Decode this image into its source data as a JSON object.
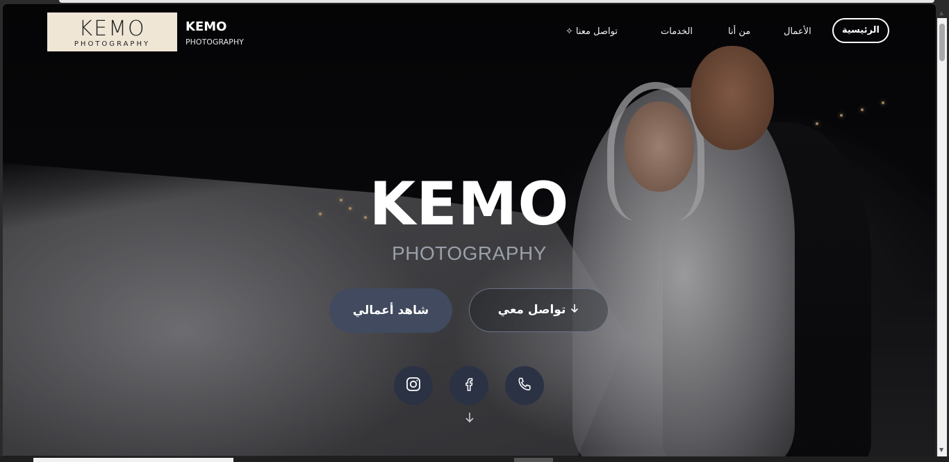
{
  "brand": {
    "logo_word": "KEMO",
    "logo_sub": "PHOTOGRAPHY",
    "name": "KEMO",
    "subtitle": "PHOTOGRAPHY"
  },
  "nav": {
    "home": "الرئيسية",
    "works": "الأعمال",
    "about": "من أنا",
    "services": "الخدمات",
    "contact": "تواصل معنا"
  },
  "hero": {
    "title": "KEMO",
    "subtitle": "PHOTOGRAPHY",
    "btn_works": "شاهد أعمالي",
    "btn_contact": "تواصل معي"
  },
  "social": {
    "icons": [
      "instagram-icon",
      "facebook-icon",
      "phone-icon"
    ]
  },
  "colors": {
    "button_fill": "#414a5e",
    "social_fill": "#2b3244",
    "subtitle": "#9aa0aa"
  }
}
